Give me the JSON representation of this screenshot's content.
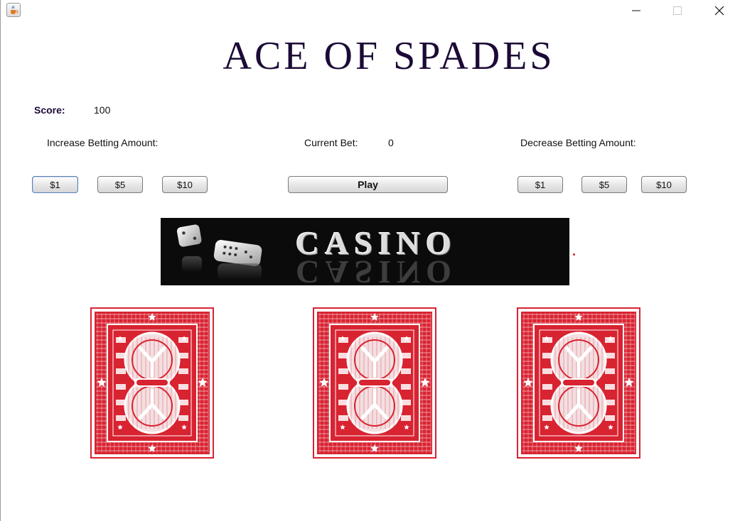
{
  "window": {
    "icons": {
      "app": "java-coffee-cup-icon",
      "minimize": "minimize-icon",
      "maximize": "maximize-icon",
      "close": "close-icon"
    }
  },
  "header": {
    "title": "ACE OF SPADES"
  },
  "score": {
    "label": "Score:",
    "value": "100"
  },
  "betting": {
    "increase_label": "Increase Betting Amount:",
    "current_bet_label": "Current Bet:",
    "current_bet_value": "0",
    "decrease_label": "Decrease Betting Amount:",
    "increase_buttons": [
      "$1",
      "$5",
      "$10"
    ],
    "decrease_buttons": [
      "$1",
      "$5",
      "$10"
    ],
    "play_label": "Play"
  },
  "banner": {
    "text": "CASINO"
  },
  "cards": [
    {
      "face": "back",
      "color": "#d82331"
    },
    {
      "face": "back",
      "color": "#d82331"
    },
    {
      "face": "back",
      "color": "#d82331"
    }
  ],
  "colors": {
    "title": "#1c0a36",
    "card": "#d82331",
    "banner_bg": "#0b0b0b"
  }
}
